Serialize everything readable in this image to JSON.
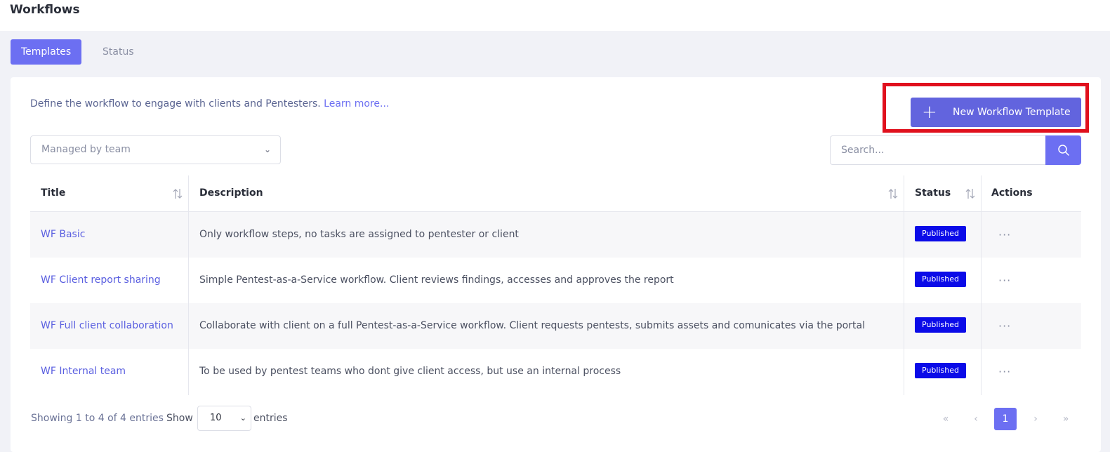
{
  "header": {
    "title": "Workflows"
  },
  "tabs": [
    {
      "label": "Templates",
      "active": true
    },
    {
      "label": "Status",
      "active": false
    }
  ],
  "intro": {
    "text": "Define the workflow to engage with clients and Pentesters.",
    "link": "Learn more..."
  },
  "new_button": {
    "label": "New Workflow Template",
    "icon": "plus-icon"
  },
  "filter": {
    "value": "Managed by team"
  },
  "search": {
    "placeholder": "Search..."
  },
  "table": {
    "columns": [
      "Title",
      "Description",
      "Status",
      "Actions"
    ],
    "rows": [
      {
        "title": "WF Basic",
        "description": "Only workflow steps, no tasks are assigned to pentester or client",
        "status": "Published",
        "actions": "···"
      },
      {
        "title": "WF Client report sharing",
        "description": "Simple Pentest-as-a-Service workflow. Client reviews findings, accesses and approves the report",
        "status": "Published",
        "actions": "···"
      },
      {
        "title": "WF Full client collaboration",
        "description": "Collaborate with client on a full Pentest-as-a-Service workflow. Client requests pentests, submits assets and comunicates via the portal",
        "status": "Published",
        "actions": "···"
      },
      {
        "title": "WF Internal team",
        "description": "To be used by pentest teams who dont give client access, but use an internal process",
        "status": "Published",
        "actions": "···"
      }
    ]
  },
  "footer": {
    "info": "Showing 1 to 4 of 4 entries",
    "show_label": "Show",
    "page_size": "10",
    "entries_label": "entries",
    "current_page": "1"
  },
  "colors": {
    "accent": "#6c6ff2",
    "badge": "#0b0be8",
    "highlight": "#e0101d"
  }
}
